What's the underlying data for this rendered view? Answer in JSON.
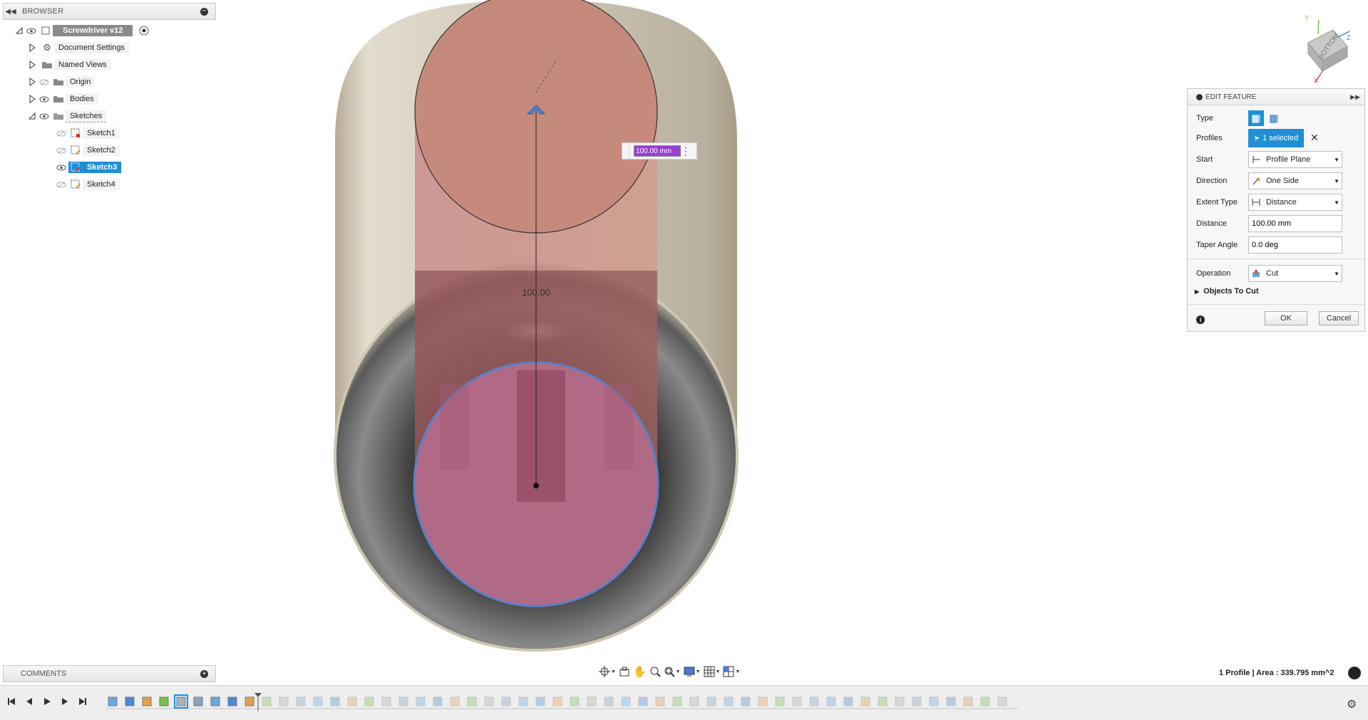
{
  "browser": {
    "title": "BROWSER",
    "root_label": "Screwdriver v12",
    "items": [
      {
        "label": "Document Settings",
        "icon": "gear-icon"
      },
      {
        "label": "Named Views",
        "icon": "folder-icon"
      },
      {
        "label": "Origin",
        "icon": "folder-icon"
      },
      {
        "label": "Bodies",
        "icon": "folder-icon"
      },
      {
        "label": "Sketches",
        "icon": "folder-icon"
      }
    ],
    "sketches": [
      "Sketch1",
      "Sketch2",
      "Sketch3",
      "Sketch4"
    ]
  },
  "viewport": {
    "dimension_label": "100.00",
    "dimension_input": "100.00 mm"
  },
  "viewcube": {
    "face_label": "BOTTOM",
    "axis_y": "Y",
    "axis_z": "Z",
    "axis_x": "X"
  },
  "edit_feature": {
    "title": "EDIT FEATURE",
    "type_label": "Type",
    "profiles_label": "Profiles",
    "profiles_value": "1 selected",
    "start_label": "Start",
    "start_value": "Profile Plane",
    "direction_label": "Direction",
    "direction_value": "One Side",
    "extent_label": "Extent Type",
    "extent_value": "Distance",
    "distance_label": "Distance",
    "distance_value": "100.00 mm",
    "taper_label": "Taper Angle",
    "taper_value": "0.0 deg",
    "operation_label": "Operation",
    "operation_value": "Cut",
    "objects_to_cut": "Objects To Cut",
    "ok": "OK",
    "cancel": "Cancel"
  },
  "comments": {
    "title": "COMMENTS"
  },
  "status": {
    "profile_info": "1 Profile | Area : 339.795 mm^2"
  },
  "colors": {
    "accent": "#1f8fd6",
    "body_beige": "#c7bfae",
    "profile_pink": "#c97b7b",
    "selected_profile": "#b06a86"
  }
}
